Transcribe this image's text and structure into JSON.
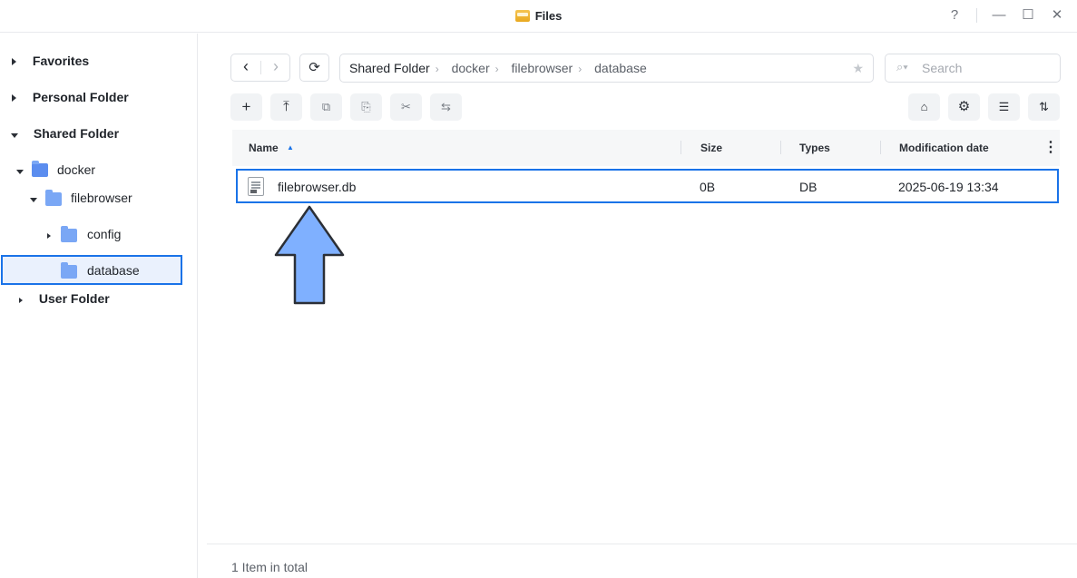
{
  "window": {
    "title": "Files",
    "help": "?",
    "minimize": "—",
    "maximize": "☐",
    "close": "✕"
  },
  "sidebar": {
    "favorites": "Favorites",
    "personal_folder": "Personal Folder",
    "shared_folder": "Shared Folder",
    "docker": "docker",
    "filebrowser": "filebrowser",
    "config": "config",
    "database": "database",
    "user_folder": "User Folder"
  },
  "nav": {
    "back": "‹",
    "forward": "›",
    "refresh": "⟳"
  },
  "breadcrumb": [
    "Shared Folder",
    "docker",
    "filebrowser",
    "database"
  ],
  "search": {
    "placeholder": "Search"
  },
  "toolbar": {
    "create": "+",
    "upload": "⤒",
    "copy": "⧉",
    "paste": "⎘",
    "cut": "✂",
    "move": "⇆",
    "tools": "⌂",
    "settings": "⚙",
    "view": "☰",
    "sort": "⇅"
  },
  "table": {
    "headers": {
      "name": "Name",
      "size": "Size",
      "types": "Types",
      "modified": "Modification date"
    },
    "sort_indicator": "▲",
    "rows": [
      {
        "name": "filebrowser.db",
        "size": "0B",
        "type": "DB",
        "modified": "2025-06-19 13:34"
      }
    ]
  },
  "footer": {
    "count": "1 Item in total"
  },
  "colors": {
    "accent": "#1a73e8",
    "arrow_fill": "#7fb0ff",
    "folder": "#7aa7f5"
  }
}
